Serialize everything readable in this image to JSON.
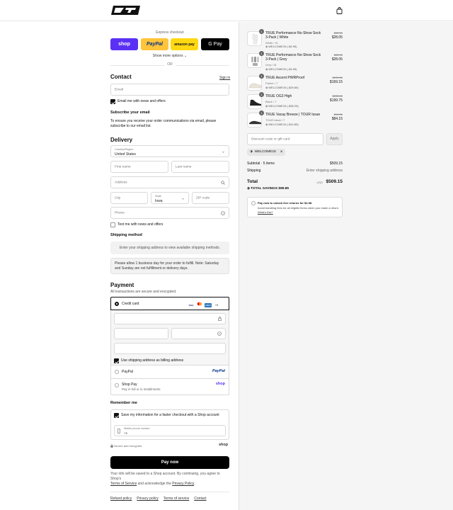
{
  "express": {
    "title": "Express checkout",
    "shop": "shop",
    "paypal": "PayPal",
    "amazon": "amazon pay",
    "gpay": "G Pay",
    "more": "Show more options",
    "or": "OR"
  },
  "contact": {
    "title": "Contact",
    "signin": "Sign in",
    "email_placeholder": "Email",
    "news": "Email me with news and offers",
    "subscribe_title": "Subscribe your email",
    "subscribe_text": "To ensure you receive your order communications via email, please subscribe to our email list."
  },
  "delivery": {
    "title": "Delivery",
    "country_label": "Country/Region",
    "country": "United States",
    "first": "First name",
    "last": "Last name",
    "address": "Address",
    "city": "City",
    "state_label": "State",
    "state": "Iowa",
    "zip": "ZIP code",
    "phone": "Phone",
    "sms": "Text me with news and offers"
  },
  "shipping": {
    "title": "Shipping method",
    "placeholder": "Enter your shipping address to view available shipping methods.",
    "note": "Please allow 1 business day for your order to fulfill. Note: Saturday and Sunday are not fulfillment or delivery days."
  },
  "payment": {
    "title": "Payment",
    "subtitle": "All transactions are secure and encrypted.",
    "credit": "Credit card",
    "visa": "VISA",
    "amex": "AMEX",
    "more_cards": "+5",
    "billing": "Use shipping address as billing address",
    "paypal": "PayPal",
    "paypal_logo": "PayPal",
    "shoppay": "Shop Pay",
    "shoppay_sub": "Pay in full or in installments",
    "shop_logo": "shop"
  },
  "remember": {
    "title": "Remember me",
    "save": "Save my information for a faster checkout with a Shop account",
    "mobile_label": "Mobile phone number",
    "mobile_value": "+1",
    "secure": "Secure and encrypted",
    "shop": "shop"
  },
  "paynow": "Pay now",
  "terms": {
    "text1": "Your info will be saved to a Shop account. By continuing, you agree to Shop's",
    "tos": "Terms of Service",
    "and": "and acknowledge the",
    "privacy": "Privacy Policy",
    "end": "."
  },
  "footer": [
    "Refund policy",
    "Privacy policy",
    "Terms of service",
    "Contact"
  ],
  "summary": {
    "products": [
      {
        "name": "TRUE Performance No-Show Sock 3-Pack | White",
        "variant": "White / XL",
        "discount": "WELCOME15 (-$4.95)",
        "old": "$32.99",
        "new": "$28.05",
        "qty": "1"
      },
      {
        "name": "TRUE Performance No-Show Sock 3-Pack | Grey",
        "variant": "Grey / M",
        "discount": "WELCOME15 (-$4.95)",
        "old": "$32.99",
        "new": "$28.05",
        "qty": "1"
      },
      {
        "name": "TRUE Ascent PWRProof",
        "variant": "Parker / 7",
        "discount": "WELCOME15 (-$29.85)",
        "old": "$199.00",
        "new": "$169.15",
        "qty": "1"
      },
      {
        "name": "TRUE OG3 High",
        "variant": "Black / 7",
        "discount": "WELCOME15 (-$35.25)",
        "old": "$235.00",
        "new": "$199.75",
        "qty": "1"
      },
      {
        "name": "TRUE Vacay Breeze | TOUR Issue",
        "variant": "TOUR black / 7",
        "discount": "WELCOME15 (-$14.85)",
        "old": "$99.00",
        "new": "$84.15",
        "qty": "1"
      }
    ],
    "discount_placeholder": "Discount code or gift card",
    "apply": "Apply",
    "tag": "WELCOME15",
    "subtotal_label": "Subtotal · 5 items",
    "subtotal": "$509.15",
    "shipping_label": "Shipping",
    "shipping_value": "Enter shipping address",
    "total_label": "Total",
    "currency": "USD",
    "total": "$509.15",
    "savings_label": "TOTAL SAVINGS",
    "savings": "$89.85",
    "returns_title": "Pay now to unlock free returns for $4.98.",
    "returns_text": "Avoid handling fees for all eligible items when you make a return.",
    "returns_link": "What's this?"
  }
}
